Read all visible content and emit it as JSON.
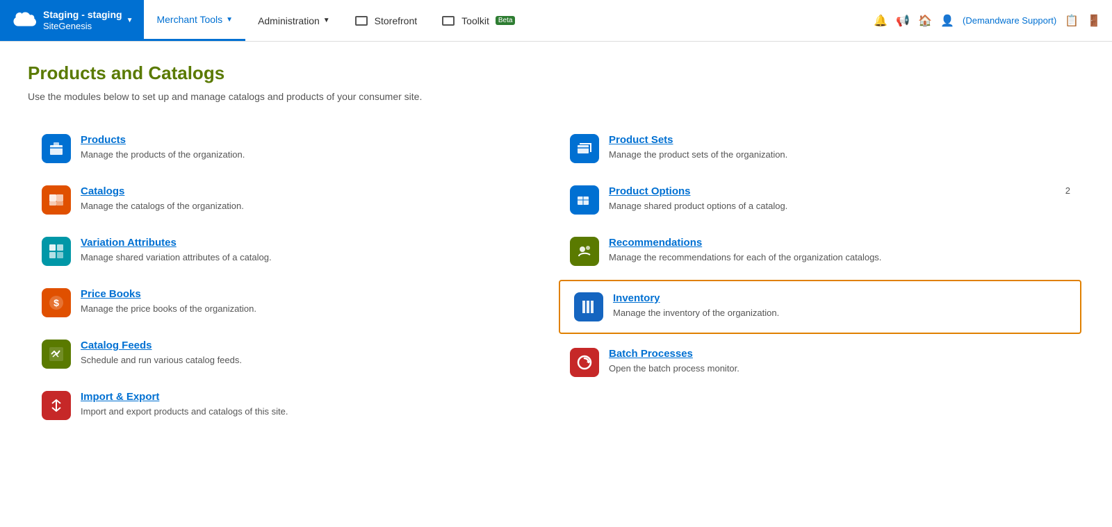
{
  "navbar": {
    "brand": {
      "site": "Staging - staging",
      "name": "SiteGenesis"
    },
    "nav_items": [
      {
        "id": "merchant-tools",
        "label": "Merchant Tools",
        "has_dropdown": true,
        "active": true,
        "has_monitor": false
      },
      {
        "id": "administration",
        "label": "Administration",
        "has_dropdown": true,
        "active": false,
        "has_monitor": false
      },
      {
        "id": "storefront",
        "label": "Storefront",
        "has_dropdown": false,
        "active": false,
        "has_monitor": true
      },
      {
        "id": "toolkit",
        "label": "Toolkit",
        "has_dropdown": false,
        "active": false,
        "has_monitor": true,
        "beta": true
      }
    ],
    "right": {
      "support_text": "(Demandware Support)"
    }
  },
  "page": {
    "title": "Products and Catalogs",
    "description": "Use the modules below to set up and manage catalogs and products of your consumer site."
  },
  "modules": {
    "left": [
      {
        "id": "products",
        "label": "Products",
        "description": "Manage the products of the organization.",
        "icon_color": "blue",
        "icon_symbol": "👟"
      },
      {
        "id": "catalogs",
        "label": "Catalogs",
        "description": "Manage the catalogs of the organization.",
        "icon_color": "orange",
        "icon_symbol": "🗂"
      },
      {
        "id": "variation-attributes",
        "label": "Variation Attributes",
        "description": "Manage shared variation attributes of a catalog.",
        "icon_color": "teal",
        "icon_symbol": "⊞"
      },
      {
        "id": "price-books",
        "label": "Price Books",
        "description": "Manage the price books of the organization.",
        "icon_color": "orange",
        "icon_symbol": "$"
      },
      {
        "id": "catalog-feeds",
        "label": "Catalog Feeds",
        "description": "Schedule and run various catalog feeds.",
        "icon_color": "green",
        "icon_symbol": "⇄"
      },
      {
        "id": "import-export",
        "label": "Import & Export",
        "description": "Import and export products and catalogs of this site.",
        "icon_color": "red",
        "icon_symbol": "↕"
      }
    ],
    "right": [
      {
        "id": "product-sets",
        "label": "Product Sets",
        "description": "Manage the product sets of the organization.",
        "icon_color": "blue",
        "icon_symbol": "📦",
        "highlighted": false
      },
      {
        "id": "product-options",
        "label": "Product Options",
        "description": "Manage shared product options of a catalog.",
        "icon_color": "blue",
        "icon_symbol": "🔧",
        "highlighted": false,
        "badge": "2"
      },
      {
        "id": "recommendations",
        "label": "Recommendations",
        "description": "Manage the recommendations for each of the organization catalogs.",
        "icon_color": "green",
        "icon_symbol": "★",
        "highlighted": false
      },
      {
        "id": "inventory",
        "label": "Inventory",
        "description": "Manage the inventory of the organization.",
        "icon_color": "blue2",
        "icon_symbol": "≡",
        "highlighted": true
      },
      {
        "id": "batch-processes",
        "label": "Batch Processes",
        "description": "Open the batch process monitor.",
        "icon_color": "red",
        "icon_symbol": "↺",
        "highlighted": false
      }
    ]
  }
}
